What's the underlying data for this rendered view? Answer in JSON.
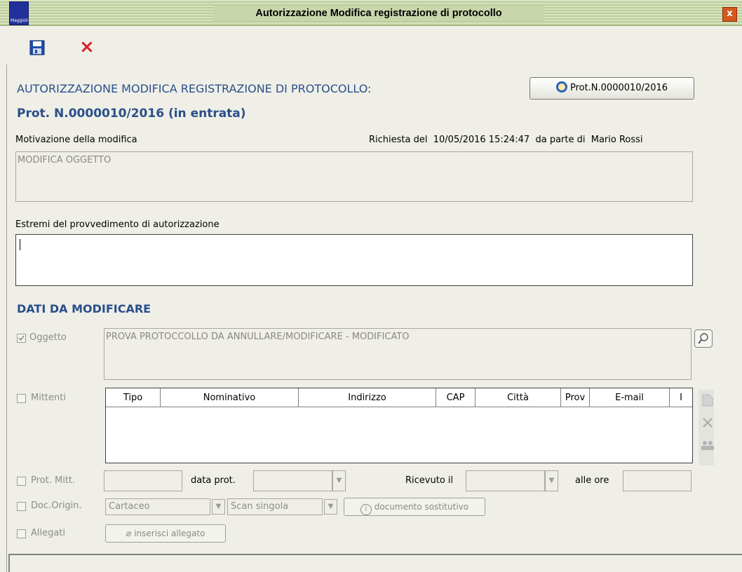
{
  "window": {
    "title": "Autorizzazione Modifica registrazione di protocollo",
    "app_icon_text": "Maggioli",
    "close_glyph": "x"
  },
  "toolbar": {
    "save_icon": "floppy-disk-icon",
    "cancel_glyph": "×"
  },
  "header": {
    "section_title": "AUTORIZZAZIONE MODIFICA REGISTRAZIONE DI PROTOCOLLO:",
    "prot_button": "Prot.N.0000010/2016",
    "prot_subtitle": "Prot. N.0000010/2016 (in entrata)"
  },
  "motivation": {
    "label": "Motivazione della modifica",
    "request_prefix": "Richiesta del",
    "request_date": "10/05/2016 15:24:47",
    "by_prefix": "da parte di",
    "user": "Mario Rossi",
    "value": "MODIFICA OGGETTO"
  },
  "provvedimento": {
    "label": "Estremi del provvedimento di autorizzazione",
    "value": ""
  },
  "dati": {
    "title": "DATI DA MODIFICARE",
    "oggetto": {
      "label": "Oggetto",
      "checked": true,
      "value": "PROVA PROTOCCOLLO DA ANNULLARE/MODIFICARE - MODIFICATO"
    },
    "mittenti": {
      "label": "Mittenti",
      "columns": [
        "Tipo",
        "Nominativo",
        "Indirizzo",
        "CAP",
        "Città",
        "Prov",
        "E-mail",
        "I"
      ]
    },
    "prot_mitt": {
      "label": "Prot. Mitt.",
      "data_prot_label": "data prot.",
      "ricevuto_label": "Ricevuto il",
      "alle_ore_label": "alle ore"
    },
    "doc_origin": {
      "label": "Doc.Origin.",
      "select1": "Cartaceo",
      "select2": "Scan singola",
      "button": "documento sostitutivo"
    },
    "allegati": {
      "label": "Allegati",
      "button": "inserisci allegato"
    }
  }
}
